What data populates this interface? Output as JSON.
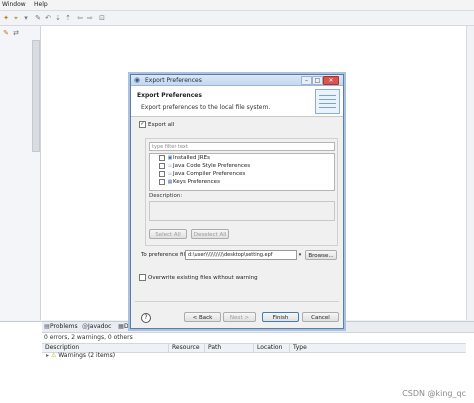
{
  "menu": [
    "Window",
    "Help"
  ],
  "dialog": {
    "title": "Export Preferences",
    "banner_title": "Export Preferences",
    "banner_desc": "Export preferences to the local file system.",
    "export_all_label": "Export all",
    "export_all_checked": true,
    "filter_placeholder": "type filter text",
    "tree_items": [
      {
        "label": "Installed JREs"
      },
      {
        "label": "Java Code Style Preferences"
      },
      {
        "label": "Java Compiler Preferences"
      },
      {
        "label": "Keys Preferences"
      }
    ],
    "description_label": "Description:",
    "select_all": "Select All",
    "deselect_all": "Deselect All",
    "pref_file_label": "To preference file:",
    "pref_file_value": "d:\\user\\\\\\\\\\\\\\\\\\\\\\desktop\\setting.epf",
    "browse": "Browse...",
    "overwrite_label": "Overwrite existing files without warning",
    "back": "< Back",
    "next": "Next >",
    "finish": "Finish",
    "cancel": "Cancel"
  },
  "panel": {
    "tabs": [
      "Problems",
      "Javadoc",
      "De"
    ],
    "status": "0 errors, 2 warnings, 0 others",
    "columns": [
      "Description",
      "Resource",
      "Path",
      "Location",
      "Type"
    ],
    "warning_row": "Warnings (2 items)"
  },
  "watermark": "CSDN @king_qc"
}
